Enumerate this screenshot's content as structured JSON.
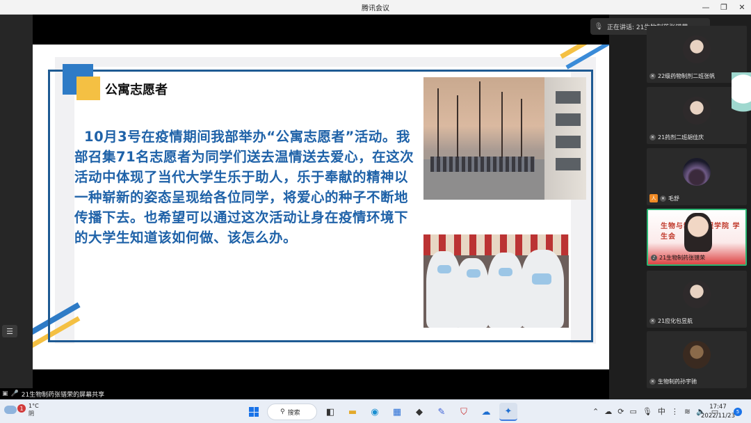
{
  "window": {
    "title": "腾讯会议"
  },
  "slide": {
    "heading": "公寓志愿者",
    "body": "10月3号在疫情期间我部举办“公寓志愿者”活动。我部召集71名志愿者为同学们送去温情送去爱心，在这次活动中体现了当代大学生乐于助人，乐于奉献的精神以一种崭新的姿态呈现给各位同学，将爱心的种子不断地传播下去。也希望可以通过这次活动让身在疫情环境下的大学生知道该如何做、该怎么办。"
  },
  "speaking": {
    "label": "正在讲话: 21生物制药张镨荣"
  },
  "participants": [
    {
      "name": "22级药物制剂二班张帆"
    },
    {
      "name": "21药剂二班胡佳庆"
    },
    {
      "name": "毛舒"
    },
    {
      "name": "21生物制药张镨荣",
      "banner": "生物与制药工程学院 学生会"
    },
    {
      "name": "21应化包昱航"
    },
    {
      "name": "生物制药孙宇驰"
    }
  ],
  "share_status": "21生物制药张镨荣的屏幕共享",
  "taskbar": {
    "weather_temp": "1°C",
    "weather_desc": "阴",
    "weather_badge": "1",
    "search_label": "搜索",
    "ime": "中",
    "time": "17:47",
    "date": "2022/11/23",
    "notification_count": "5"
  },
  "colors": {
    "slide_text": "#1f62a8",
    "accent_blue": "#2e7bc6",
    "accent_yellow": "#f4c043",
    "active_border": "#2bb673"
  }
}
